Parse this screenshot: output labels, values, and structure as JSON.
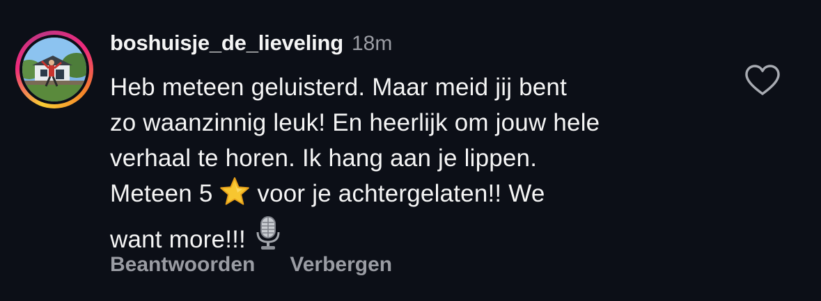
{
  "comment": {
    "username": "boshuisje_de_lieveling",
    "time": "18m",
    "lines": [
      "Heb meteen geluisterd. Maar meid jij bent",
      "zo waanzinnig leuk! En heerlijk om jouw hele",
      "verhaal te horen. Ik hang aan je lippen."
    ],
    "line4_before": "Meteen 5",
    "line4_after": "voor je achtergelaten!! We",
    "line5_before": "want more!!!",
    "emoji_star": "star-emoji",
    "emoji_mic": "microphone-emoji",
    "actions": {
      "reply": "Beantwoorden",
      "hide": "Verbergen"
    },
    "like_icon": "heart-icon"
  },
  "colors": {
    "background": "#0c0f17",
    "text_primary": "#f5f5f5",
    "text_secondary": "#9a9ca3",
    "ring_yellow": "#f9ce34",
    "ring_pink": "#ee2a7b"
  }
}
